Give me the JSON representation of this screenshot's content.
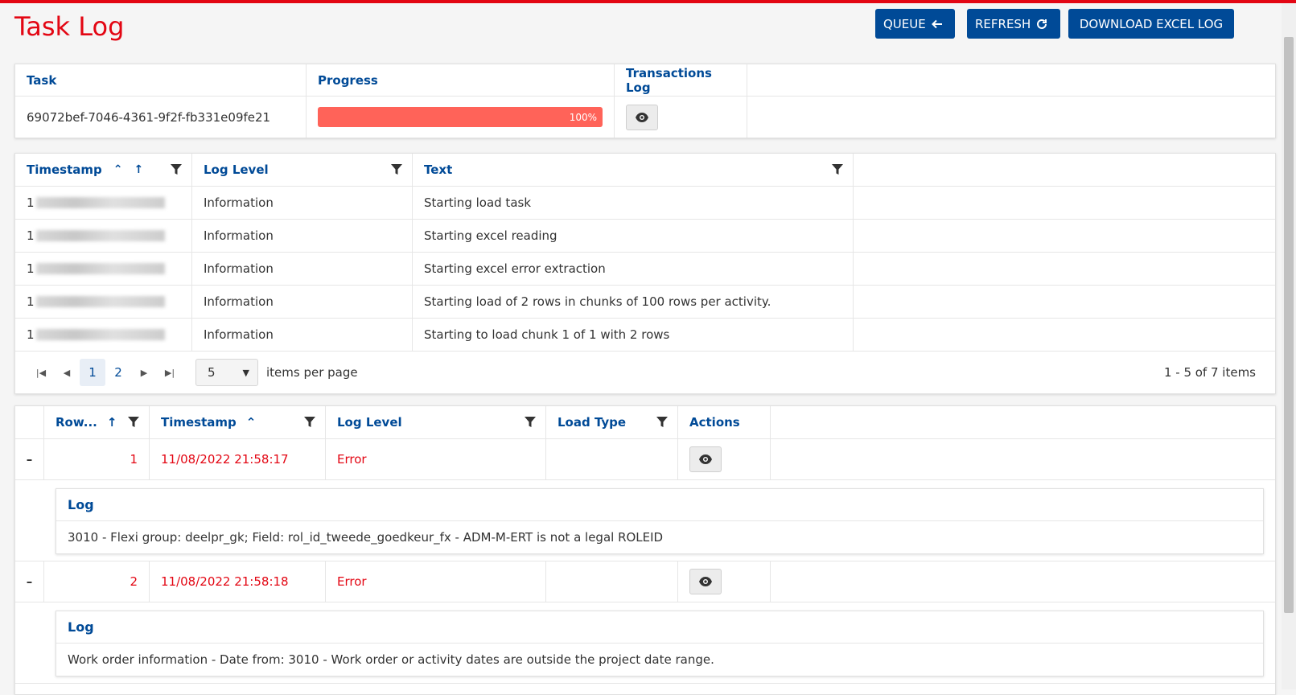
{
  "header": {
    "title": "Task Log",
    "queue_label": "QUEUE",
    "refresh_label": "REFRESH",
    "download_label": "DOWNLOAD EXCEL LOG"
  },
  "task_table": {
    "columns": [
      "Task",
      "Progress",
      "Transactions Log"
    ],
    "task_id": "69072bef-7046-4361-9f2f-fb331e09fe21",
    "progress_percent": 100,
    "progress_label": "100%"
  },
  "log_table": {
    "columns": [
      "Timestamp",
      "Log Level",
      "Text"
    ],
    "rows": [
      {
        "timestamp": "1",
        "level": "Information",
        "text": "Starting load task"
      },
      {
        "timestamp": "1",
        "level": "Information",
        "text": "Starting excel reading"
      },
      {
        "timestamp": "1",
        "level": "Information",
        "text": "Starting excel error extraction"
      },
      {
        "timestamp": "1",
        "level": "Information",
        "text": "Starting load of 2 rows in chunks of 100 rows per activity."
      },
      {
        "timestamp": "1",
        "level": "Information",
        "text": "Starting to load chunk 1 of 1 with 2 rows"
      }
    ],
    "pager": {
      "pages": [
        "1",
        "2"
      ],
      "page_size": "5",
      "items_per_page_label": "items per page",
      "info": "1 - 5 of 7 items"
    }
  },
  "row_table": {
    "columns": [
      "Row...",
      "Timestamp",
      "Log Level",
      "Load Type",
      "Actions"
    ],
    "rows": [
      {
        "toggle": "–",
        "row": "1",
        "timestamp": "11/08/2022 21:58:17",
        "level": "Error",
        "load_type": "",
        "detail_header": "Log",
        "detail_text": "3010 - Flexi group: deelpr_gk; Field: rol_id_tweede_goedkeur_fx - ADM-M-ERT is not a legal ROLEID"
      },
      {
        "toggle": "–",
        "row": "2",
        "timestamp": "11/08/2022 21:58:18",
        "level": "Error",
        "load_type": "",
        "detail_header": "Log",
        "detail_text": "Work order information - Date from: 3010 - Work order or activity dates are outside the project date range."
      }
    ]
  },
  "colors": {
    "brand_red": "#e30613",
    "primary_blue": "#004a97",
    "progress_fill": "#ff6359"
  }
}
